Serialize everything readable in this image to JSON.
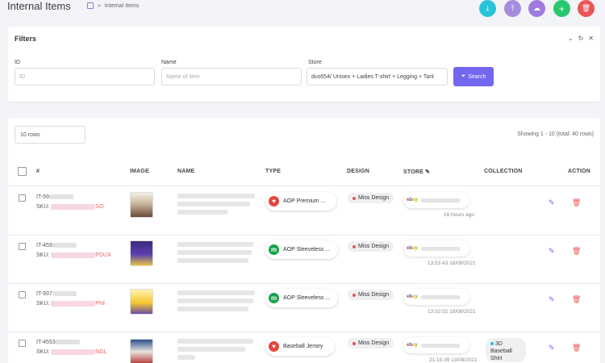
{
  "header": {
    "title": "Internal Items",
    "breadcrumb_sep": "»",
    "breadcrumb_current": "Internal Items",
    "actions": [
      {
        "name": "download",
        "color": "#28c3d7",
        "glyph": "⤓"
      },
      {
        "name": "upload",
        "color": "#a78bdf",
        "glyph": "⤒"
      },
      {
        "name": "cloud-upload",
        "color": "#9f7be0",
        "glyph": "☁"
      },
      {
        "name": "add",
        "color": "#28c76f",
        "glyph": "+"
      },
      {
        "name": "delete",
        "color": "#ea5455",
        "glyph": "🗑"
      }
    ]
  },
  "filters": {
    "title": "Filters",
    "id_label": "ID",
    "id_placeholder": "ID",
    "name_label": "Name",
    "name_placeholder": "Name of item",
    "store_label": "Store",
    "store_value": "dus654/ Unisex + Ladies T-shirt + Legging + Tanl",
    "search_label": "Search"
  },
  "list": {
    "rows_value": "10 rows",
    "showing": "Showing 1 - 10 (total: 40 rows)",
    "columns": {
      "num": "#",
      "image": "IMAGE",
      "name": "NAME",
      "type": "TYPE",
      "design": "DESIGN",
      "store": "STORE",
      "collection": "COLLECTION",
      "action": "ACTION"
    },
    "rows": [
      {
        "id_prefix": "IT-59",
        "id_suffix": "",
        "sku_label": "SKU:",
        "sku_tail": "SO",
        "type": "AOP Premium ...",
        "type_color": "#e0483f",
        "type_glyph": "♥",
        "design": "Miss Design",
        "time": "16 hours ago",
        "collection": ""
      },
      {
        "id_prefix": "IT-459",
        "id_suffix": "",
        "sku_label": "SKU:",
        "sku_tail": "PDUX",
        "type": "AOP Sleeveless ...",
        "type_color": "#17a34a",
        "type_glyph": "m",
        "design": "Miss Design",
        "time": "13:53:43 18/08/2021",
        "collection": ""
      },
      {
        "id_prefix": "IT-937",
        "id_suffix": "",
        "sku_label": "SKU:",
        "sku_tail": "PNI",
        "type": "AOP Sleeveless ...",
        "type_color": "#17a34a",
        "type_glyph": "m",
        "design": "Miss Design",
        "time": "13:32:02 18/08/2021",
        "collection": ""
      },
      {
        "id_prefix": "IT-4553",
        "id_suffix": "",
        "sku_label": "SKU:",
        "sku_tail": "NGL",
        "type": "Baseball Jersey",
        "type_color": "#e0483f",
        "type_glyph": "♥",
        "design": "Miss Design",
        "time": "21:15:39 13/08/2021",
        "collection": "3D Baseball Shirt"
      }
    ]
  }
}
